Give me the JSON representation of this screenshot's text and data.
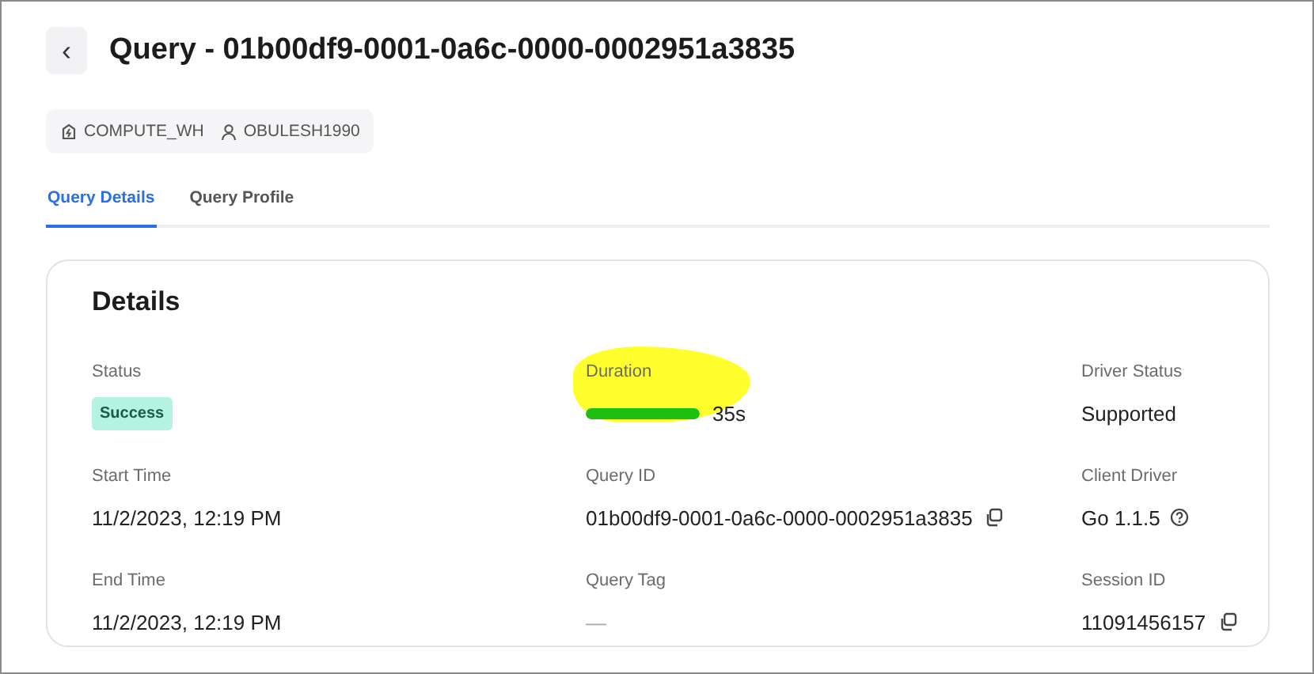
{
  "header": {
    "back_icon": "‹",
    "title": "Query - 01b00df9-0001-0a6c-0000-0002951a3835"
  },
  "chips": [
    {
      "kind": "warehouse",
      "label": "COMPUTE_WH"
    },
    {
      "kind": "user",
      "label": "OBULESH1990"
    }
  ],
  "tabs": [
    {
      "label": "Query Details",
      "selected": true
    },
    {
      "label": "Query Profile",
      "selected": false
    }
  ],
  "details": {
    "title": "Details",
    "fields": [
      {
        "label": "Status",
        "kind": "badge",
        "value": "Success"
      },
      {
        "label": "Duration",
        "kind": "duration",
        "level": 1,
        "value": "35s",
        "highlighted": true
      },
      {
        "label": "Driver Status",
        "kind": "text",
        "value": "Supported"
      },
      {
        "label": "Start Time",
        "kind": "text",
        "value": "11/2/2023, 12:19 PM"
      },
      {
        "label": "Query ID",
        "kind": "copy",
        "value": "01b00df9-0001-0a6c-0000-0002951a3835"
      },
      {
        "label": "Client Driver",
        "kind": "help",
        "value": "Go 1.1.5"
      },
      {
        "label": "End Time",
        "kind": "text",
        "value": "11/2/2023, 12:19 PM"
      },
      {
        "label": "Query Tag",
        "kind": "empty",
        "value": "—"
      },
      {
        "label": "Session ID",
        "kind": "copy",
        "value": "11091456157"
      }
    ]
  }
}
